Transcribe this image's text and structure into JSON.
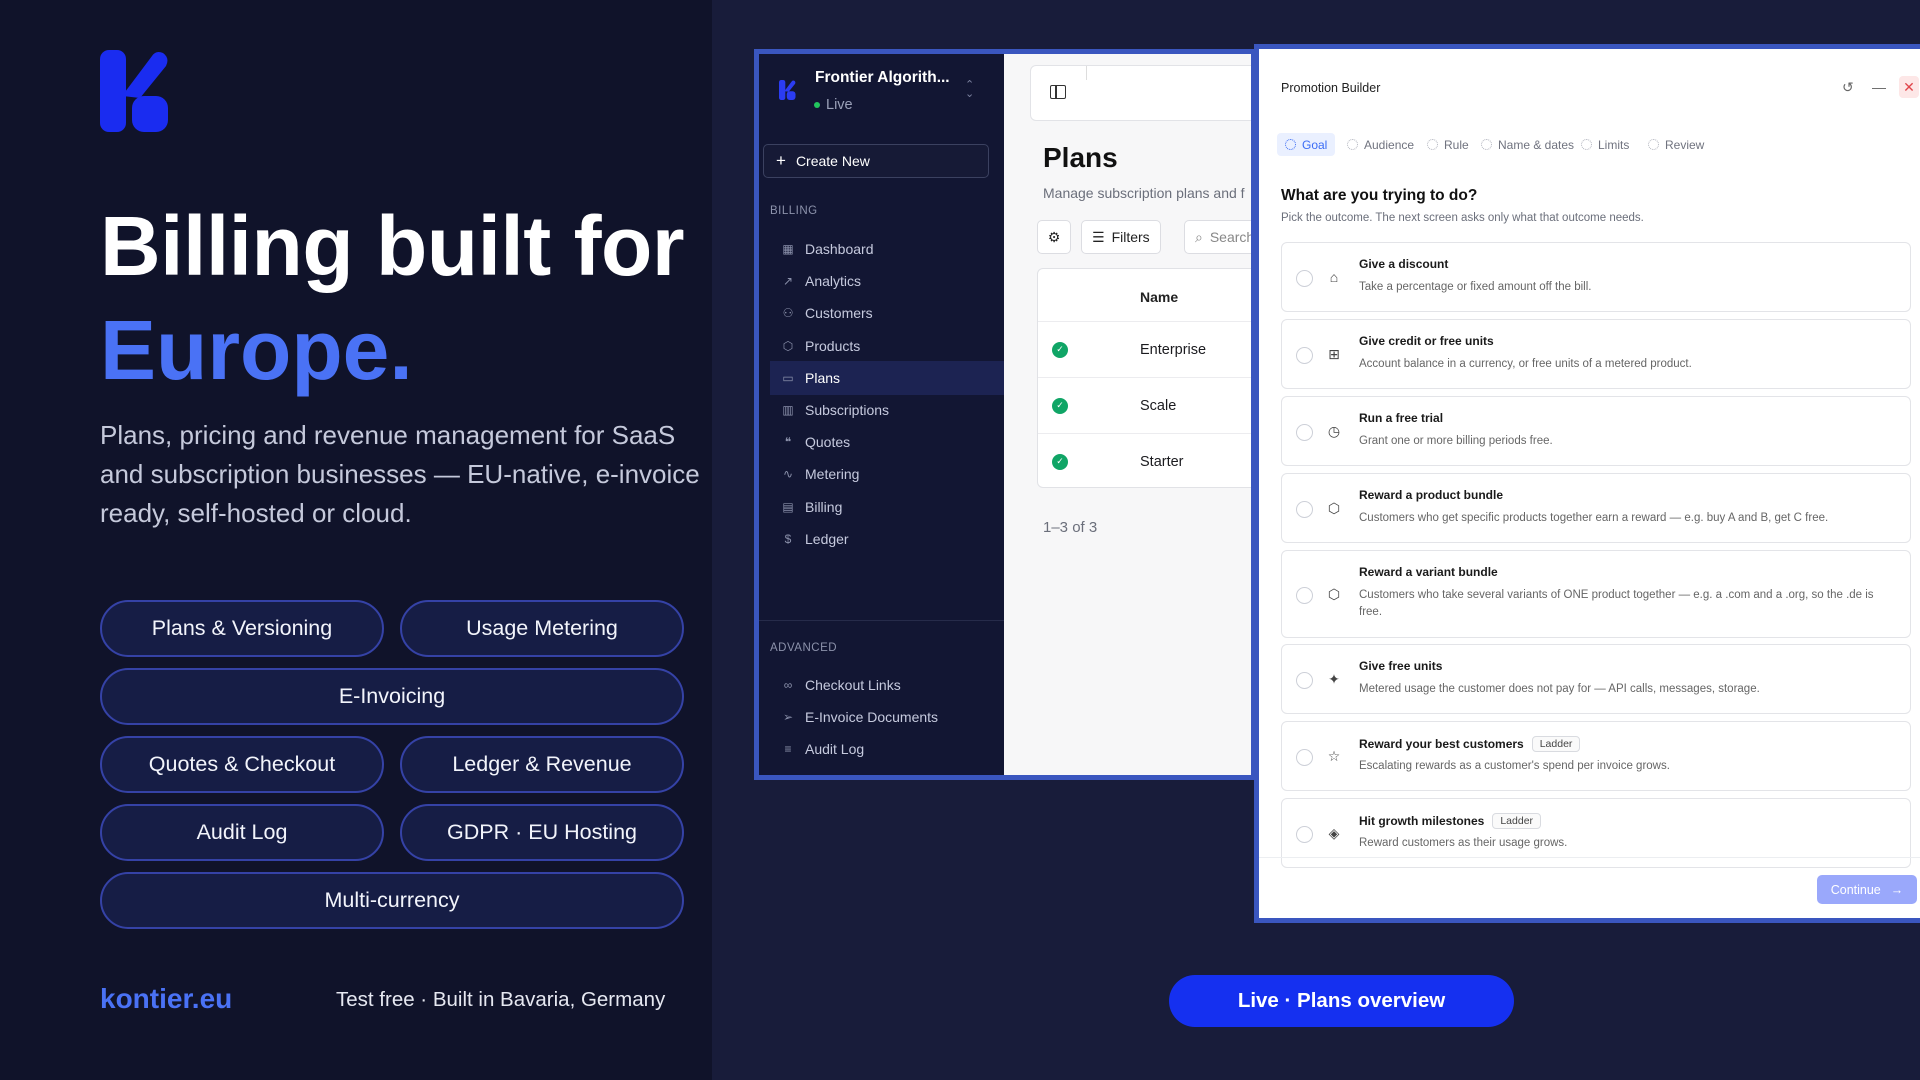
{
  "hero": {
    "headline_line1": "Billing built for",
    "headline_line2": "Europe.",
    "lead": "Plans, pricing and revenue management for SaaS and subscription businesses — EU-native, e-invoice ready, self-hosted or cloud.",
    "features": [
      "Plans & Versioning",
      "Usage Metering",
      "E-Invoicing",
      "Quotes & Checkout",
      "Ledger & Revenue",
      "Audit Log",
      "GDPR · EU Hosting",
      "Multi-currency"
    ],
    "site": "kontier.eu",
    "tagline": "Test free · Built in Bavaria, Germany",
    "live_button": "Live · Plans overview",
    "brand_color": "#4a72f5"
  },
  "app": {
    "org_name": "Frontier Algorith...",
    "status": "Live",
    "create_new": "Create New",
    "section_billing": "BILLING",
    "section_advanced": "ADVANCED",
    "nav_billing": [
      {
        "label": "Dashboard",
        "icon": "grid-icon"
      },
      {
        "label": "Analytics",
        "icon": "trend-icon"
      },
      {
        "label": "Customers",
        "icon": "users-icon"
      },
      {
        "label": "Products",
        "icon": "box-icon"
      },
      {
        "label": "Plans",
        "icon": "card-icon",
        "active": true
      },
      {
        "label": "Subscriptions",
        "icon": "bar-chart-icon"
      },
      {
        "label": "Quotes",
        "icon": "quote-icon"
      },
      {
        "label": "Metering",
        "icon": "pulse-icon"
      },
      {
        "label": "Billing",
        "icon": "receipt-icon"
      },
      {
        "label": "Ledger",
        "icon": "dollar-icon"
      }
    ],
    "nav_advanced": [
      {
        "label": "Checkout Links",
        "icon": "link-icon"
      },
      {
        "label": "E-Invoice Documents",
        "icon": "send-icon"
      },
      {
        "label": "Audit Log",
        "icon": "list-icon"
      }
    ],
    "page_title": "Plans",
    "page_subtitle": "Manage subscription plans and f",
    "filters_label": "Filters",
    "search_placeholder": "Search",
    "table_header": "Name",
    "rows": [
      "Enterprise",
      "Scale",
      "Starter"
    ],
    "pager": "1–3 of 3"
  },
  "promo": {
    "title": "Promotion Builder",
    "steps": [
      "Goal",
      "Audience",
      "Rule",
      "Name & dates",
      "Limits",
      "Review"
    ],
    "question": "What are you trying to do?",
    "question_sub": "Pick the outcome. The next screen asks only what that outcome needs.",
    "options": [
      {
        "title": "Give a discount",
        "desc": "Take a percentage or fixed amount off the bill.",
        "icon": "tag-icon"
      },
      {
        "title": "Give credit or free units",
        "desc": "Account balance in a currency, or free units of a metered product.",
        "icon": "gift-icon"
      },
      {
        "title": "Run a free trial",
        "desc": "Grant one or more billing periods free.",
        "icon": "timer-icon"
      },
      {
        "title": "Reward a product bundle",
        "desc": "Customers who get specific products together earn a reward — e.g. buy A and B, get C free.",
        "icon": "package-icon"
      },
      {
        "title": "Reward a variant bundle",
        "desc": "Customers who take several variants of ONE product together — e.g. a .com and a .org, so the .de is free.",
        "icon": "package-icon"
      },
      {
        "title": "Give free units",
        "desc": "Metered usage the customer does not pay for — API calls, messages, storage.",
        "icon": "sparkle-icon"
      },
      {
        "title": "Reward your best customers",
        "badge": "Ladder",
        "desc": "Escalating rewards as a customer's spend per invoice grows.",
        "icon": "star-icon"
      },
      {
        "title": "Hit growth milestones",
        "badge": "Ladder",
        "desc": "Reward customers as their usage grows.",
        "icon": "layers-icon"
      }
    ],
    "continue": "Continue"
  }
}
